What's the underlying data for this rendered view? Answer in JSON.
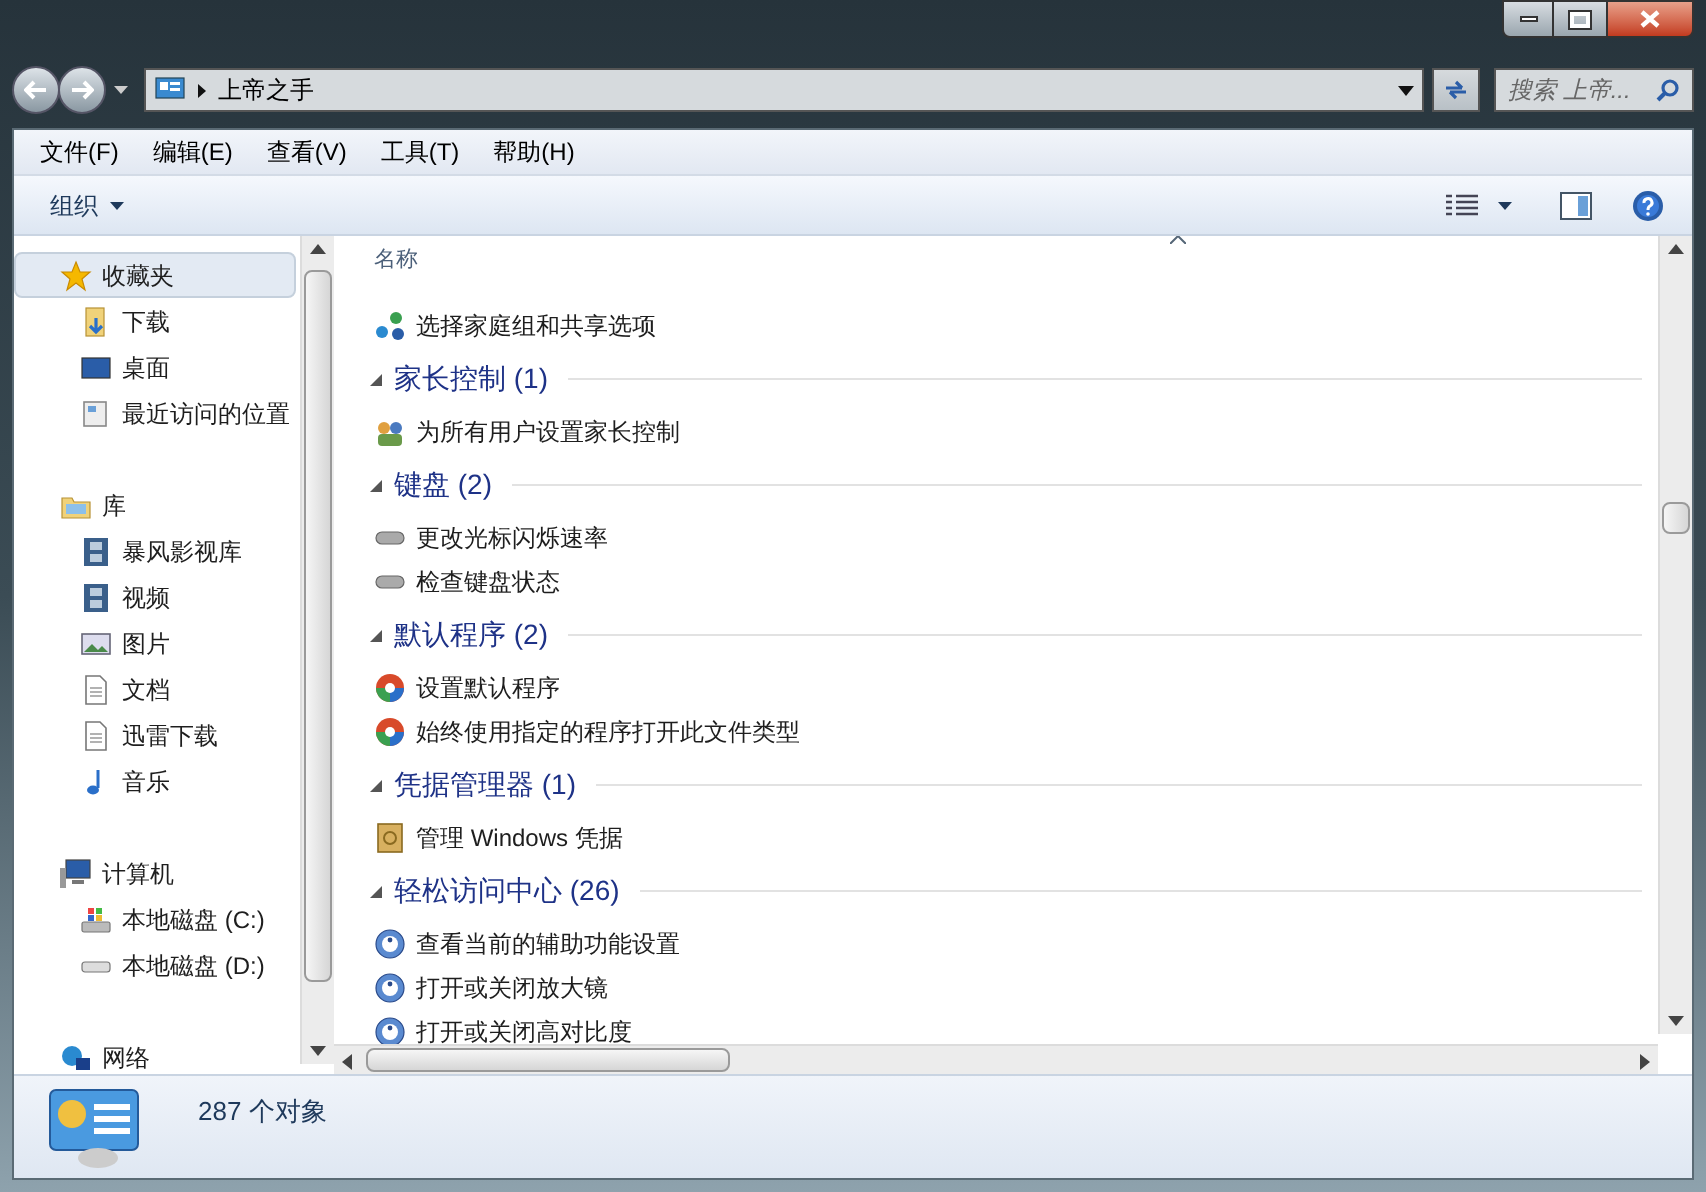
{
  "address_bar": {
    "path": [
      {
        "label": "上帝之手"
      }
    ],
    "search": {
      "placeholder": "搜索 上帝..."
    }
  },
  "menu": [
    {
      "label": "文件(F)"
    },
    {
      "label": "编辑(E)"
    },
    {
      "label": "查看(V)"
    },
    {
      "label": "工具(T)"
    },
    {
      "label": "帮助(H)"
    }
  ],
  "toolbar": {
    "organize": "组织"
  },
  "sidebar": {
    "groups": [
      {
        "label": "收藏夹",
        "kind": "favorites",
        "selected": true,
        "children": [
          {
            "label": "下载",
            "kind": "download",
            "selected": false
          },
          {
            "label": "桌面",
            "kind": "desktop",
            "selected": false
          },
          {
            "label": "最近访问的位置",
            "kind": "recent",
            "selected": false
          }
        ]
      },
      {
        "label": "库",
        "kind": "library",
        "selected": false,
        "children": [
          {
            "label": "暴风影视库",
            "kind": "video",
            "selected": false
          },
          {
            "label": "视频",
            "kind": "video",
            "selected": false
          },
          {
            "label": "图片",
            "kind": "picture",
            "selected": false
          },
          {
            "label": "文档",
            "kind": "document",
            "selected": false
          },
          {
            "label": "迅雷下载",
            "kind": "document",
            "selected": false
          },
          {
            "label": "音乐",
            "kind": "music",
            "selected": false
          }
        ]
      },
      {
        "label": "计算机",
        "kind": "computer",
        "selected": false,
        "children": [
          {
            "label": "本地磁盘 (C:)",
            "kind": "system",
            "selected": false
          },
          {
            "label": "本地磁盘 (D:)",
            "kind": "drive",
            "selected": false
          }
        ]
      },
      {
        "label": "网络",
        "kind": "network",
        "selected": false
      }
    ]
  },
  "content": {
    "column": "名称",
    "leading_items": [
      {
        "label": "选择家庭组和共享选项",
        "kind": "homegroup"
      }
    ],
    "groups": [
      {
        "title": "家长控制 (1)",
        "expanded": true,
        "items": [
          {
            "label": "为所有用户设置家长控制",
            "kind": "parental"
          }
        ]
      },
      {
        "title": "键盘 (2)",
        "expanded": true,
        "items": [
          {
            "label": "更改光标闪烁速率",
            "kind": "keyboard"
          },
          {
            "label": "检查键盘状态",
            "kind": "keyboard"
          }
        ]
      },
      {
        "title": "默认程序 (2)",
        "expanded": true,
        "items": [
          {
            "label": "设置默认程序",
            "kind": "defaults"
          },
          {
            "label": "始终使用指定的程序打开此文件类型",
            "kind": "defaults"
          }
        ]
      },
      {
        "title": "凭据管理器 (1)",
        "expanded": true,
        "items": [
          {
            "label": "管理 Windows 凭据",
            "kind": "vault"
          }
        ]
      },
      {
        "title": "轻松访问中心 (26)",
        "expanded": true,
        "items": [
          {
            "label": "查看当前的辅助功能设置",
            "kind": "access"
          },
          {
            "label": "打开或关闭放大镜",
            "kind": "access"
          },
          {
            "label": "打开或关闭高对比度",
            "kind": "access"
          }
        ]
      }
    ]
  },
  "status_bar": {
    "count": "287 个对象"
  }
}
